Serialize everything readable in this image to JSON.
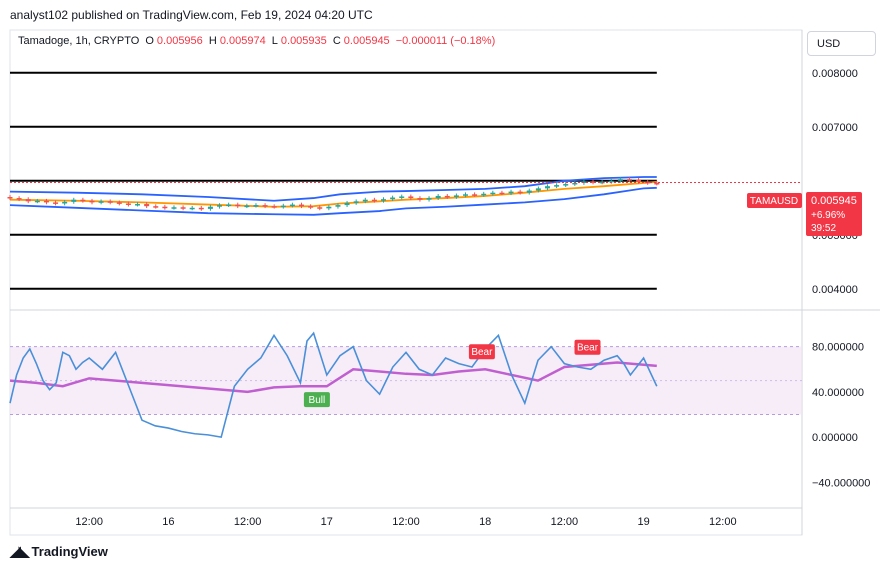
{
  "header": {
    "attribution": "analyst102 published on TradingView.com, Feb 19, 2024 04:20 UTC",
    "symbol": "Tamadoge, 1h, CRYPTO",
    "open_label": "O",
    "open": "0.005956",
    "high_label": "H",
    "high": "0.005974",
    "low_label": "L",
    "low": "0.005935",
    "close_label": "C",
    "close": "0.005945",
    "change": "−0.000011 (−0.18%)"
  },
  "currency_button": "USD",
  "price_tag": {
    "symbol": "TAMAUSD",
    "price": "0.005945",
    "pct": "+6.96%",
    "countdown": "39:52"
  },
  "colors": {
    "up": "#26a69a",
    "down": "#ef5350",
    "bb_band": "#2962ff",
    "bb_basis": "#ff9800",
    "stoch_k": "#4a90d9",
    "stoch_d": "#c060d0",
    "bull": "#4caf50",
    "bear": "#f23645",
    "level": "#000000"
  },
  "footer": {
    "logo_text": "TradingView"
  },
  "chart_data": {
    "type": "candlestick",
    "price_axis": {
      "ticks": [
        "0.008000",
        "0.007000",
        "0.005000",
        "0.004000"
      ],
      "tick_values": [
        0.008,
        0.007,
        0.005,
        0.004
      ],
      "ylim": [
        0.0037,
        0.0087
      ]
    },
    "horizontal_levels": [
      0.008,
      0.007,
      0.006,
      0.005,
      0.004
    ],
    "x_axis": {
      "labels": [
        "12:00",
        "16",
        "12:00",
        "17",
        "12:00",
        "18",
        "12:00",
        "19",
        "12:00"
      ],
      "positions": [
        12,
        24,
        36,
        48,
        60,
        72,
        84,
        96,
        108
      ],
      "xlim": [
        0,
        120
      ],
      "last_bar": 98
    },
    "bollinger": {
      "x": [
        0,
        10,
        20,
        30,
        40,
        46,
        50,
        56,
        60,
        66,
        72,
        78,
        84,
        90,
        96,
        98
      ],
      "upper": [
        0.0058,
        0.00578,
        0.00575,
        0.0057,
        0.00563,
        0.00568,
        0.00575,
        0.0058,
        0.00581,
        0.00583,
        0.00585,
        0.0059,
        0.006,
        0.00605,
        0.00607,
        0.00607
      ],
      "basis": [
        0.00565,
        0.00563,
        0.0056,
        0.00556,
        0.00552,
        0.00553,
        0.00558,
        0.00562,
        0.00565,
        0.00568,
        0.00572,
        0.00578,
        0.00585,
        0.0059,
        0.00596,
        0.00598
      ],
      "lower": [
        0.00555,
        0.0055,
        0.00545,
        0.0054,
        0.00538,
        0.00537,
        0.0054,
        0.00544,
        0.00549,
        0.00552,
        0.00556,
        0.0056,
        0.00566,
        0.00575,
        0.00586,
        0.00587
      ]
    },
    "candles_close": [
      0.00568,
      0.00566,
      0.00562,
      0.00563,
      0.0056,
      0.00558,
      0.00561,
      0.00565,
      0.00563,
      0.0056,
      0.00562,
      0.0056,
      0.00558,
      0.00556,
      0.00557,
      0.00553,
      0.00552,
      0.0055,
      0.00551,
      0.00549,
      0.0055,
      0.00548,
      0.00552,
      0.00555,
      0.00556,
      0.00553,
      0.00554,
      0.00555,
      0.00553,
      0.00552,
      0.00554,
      0.00556,
      0.00553,
      0.00551,
      0.00549,
      0.00552,
      0.00555,
      0.00559,
      0.00562,
      0.00565,
      0.00563,
      0.00566,
      0.00569,
      0.00571,
      0.00568,
      0.00565,
      0.00568,
      0.00572,
      0.0057,
      0.00573,
      0.00575,
      0.00574,
      0.00576,
      0.00578,
      0.00577,
      0.0058,
      0.00578,
      0.00582,
      0.00586,
      0.0059,
      0.00592,
      0.00594,
      0.00596,
      0.00599,
      0.00597,
      0.00598,
      0.006,
      0.00603,
      0.00602,
      0.00598,
      0.00596,
      0.00595
    ],
    "oscillator": {
      "ticks": [
        "80.000000",
        "40.000000",
        "0.000000",
        "−40.000000"
      ],
      "tick_values": [
        80,
        40,
        0,
        -40
      ],
      "ylim": [
        -60,
        108
      ],
      "band_upper": 80,
      "band_lower": 20,
      "midline": 50,
      "k_x": [
        0,
        1,
        2,
        3,
        4,
        5,
        6,
        7,
        8,
        9,
        10,
        11,
        12,
        14,
        16,
        18,
        20,
        22,
        24,
        26,
        28,
        30,
        32,
        34,
        36,
        38,
        40,
        42,
        44,
        45,
        46,
        48,
        50,
        52,
        54,
        56,
        58,
        60,
        62,
        64,
        66,
        68,
        70,
        72,
        74,
        76,
        78,
        80,
        82,
        84,
        86,
        88,
        90,
        92,
        93,
        94,
        96,
        98
      ],
      "k": [
        30,
        55,
        70,
        78,
        65,
        50,
        42,
        48,
        75,
        72,
        60,
        66,
        70,
        60,
        75,
        45,
        15,
        10,
        8,
        5,
        3,
        2,
        0,
        45,
        60,
        70,
        90,
        72,
        48,
        85,
        92,
        55,
        72,
        80,
        50,
        38,
        62,
        75,
        60,
        55,
        70,
        65,
        62,
        78,
        90,
        55,
        30,
        68,
        80,
        65,
        62,
        60,
        68,
        72,
        65,
        55,
        70,
        45,
        12,
        30
      ],
      "d_x": [
        0,
        4,
        8,
        12,
        16,
        20,
        24,
        28,
        32,
        36,
        40,
        44,
        48,
        52,
        56,
        60,
        64,
        68,
        72,
        76,
        80,
        84,
        88,
        92,
        96,
        98
      ],
      "d": [
        50,
        48,
        45,
        52,
        50,
        48,
        46,
        44,
        42,
        40,
        44,
        45,
        45,
        60,
        58,
        56,
        55,
        58,
        60,
        55,
        50,
        62,
        64,
        66,
        64,
        63
      ],
      "signals": [
        {
          "label": "Bull",
          "x": 46.5,
          "y": 38
        },
        {
          "label": "Bear",
          "x": 71.5,
          "y": 68
        },
        {
          "label": "Bear",
          "x": 87.5,
          "y": 72
        }
      ]
    }
  }
}
